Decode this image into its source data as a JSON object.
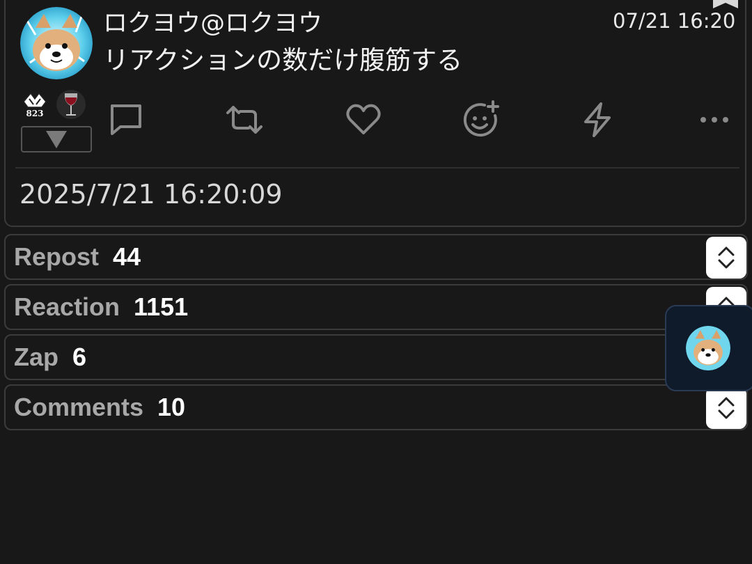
{
  "note": {
    "display_name": "ロクヨウ@ロクヨウ",
    "time_short": "07/21 16:20",
    "content": "リアクションの数だけ腹筋する",
    "badge_count": "823",
    "full_timestamp": "2025/7/21 16:20:09",
    "actions": [
      "reply-icon",
      "repost-icon",
      "like-icon",
      "add-reaction-icon",
      "zap-icon",
      "more-icon"
    ]
  },
  "stats": [
    {
      "label": "Repost",
      "value": "44"
    },
    {
      "label": "Reaction",
      "value": "1151"
    },
    {
      "label": "Zap",
      "value": "6"
    },
    {
      "label": "Comments",
      "value": "10"
    }
  ],
  "colors": {
    "background": "#181818",
    "border": "#3a3a3a",
    "label": "#a8a8a8",
    "value": "#ffffff",
    "floating_panel": "#0f1a2a"
  }
}
